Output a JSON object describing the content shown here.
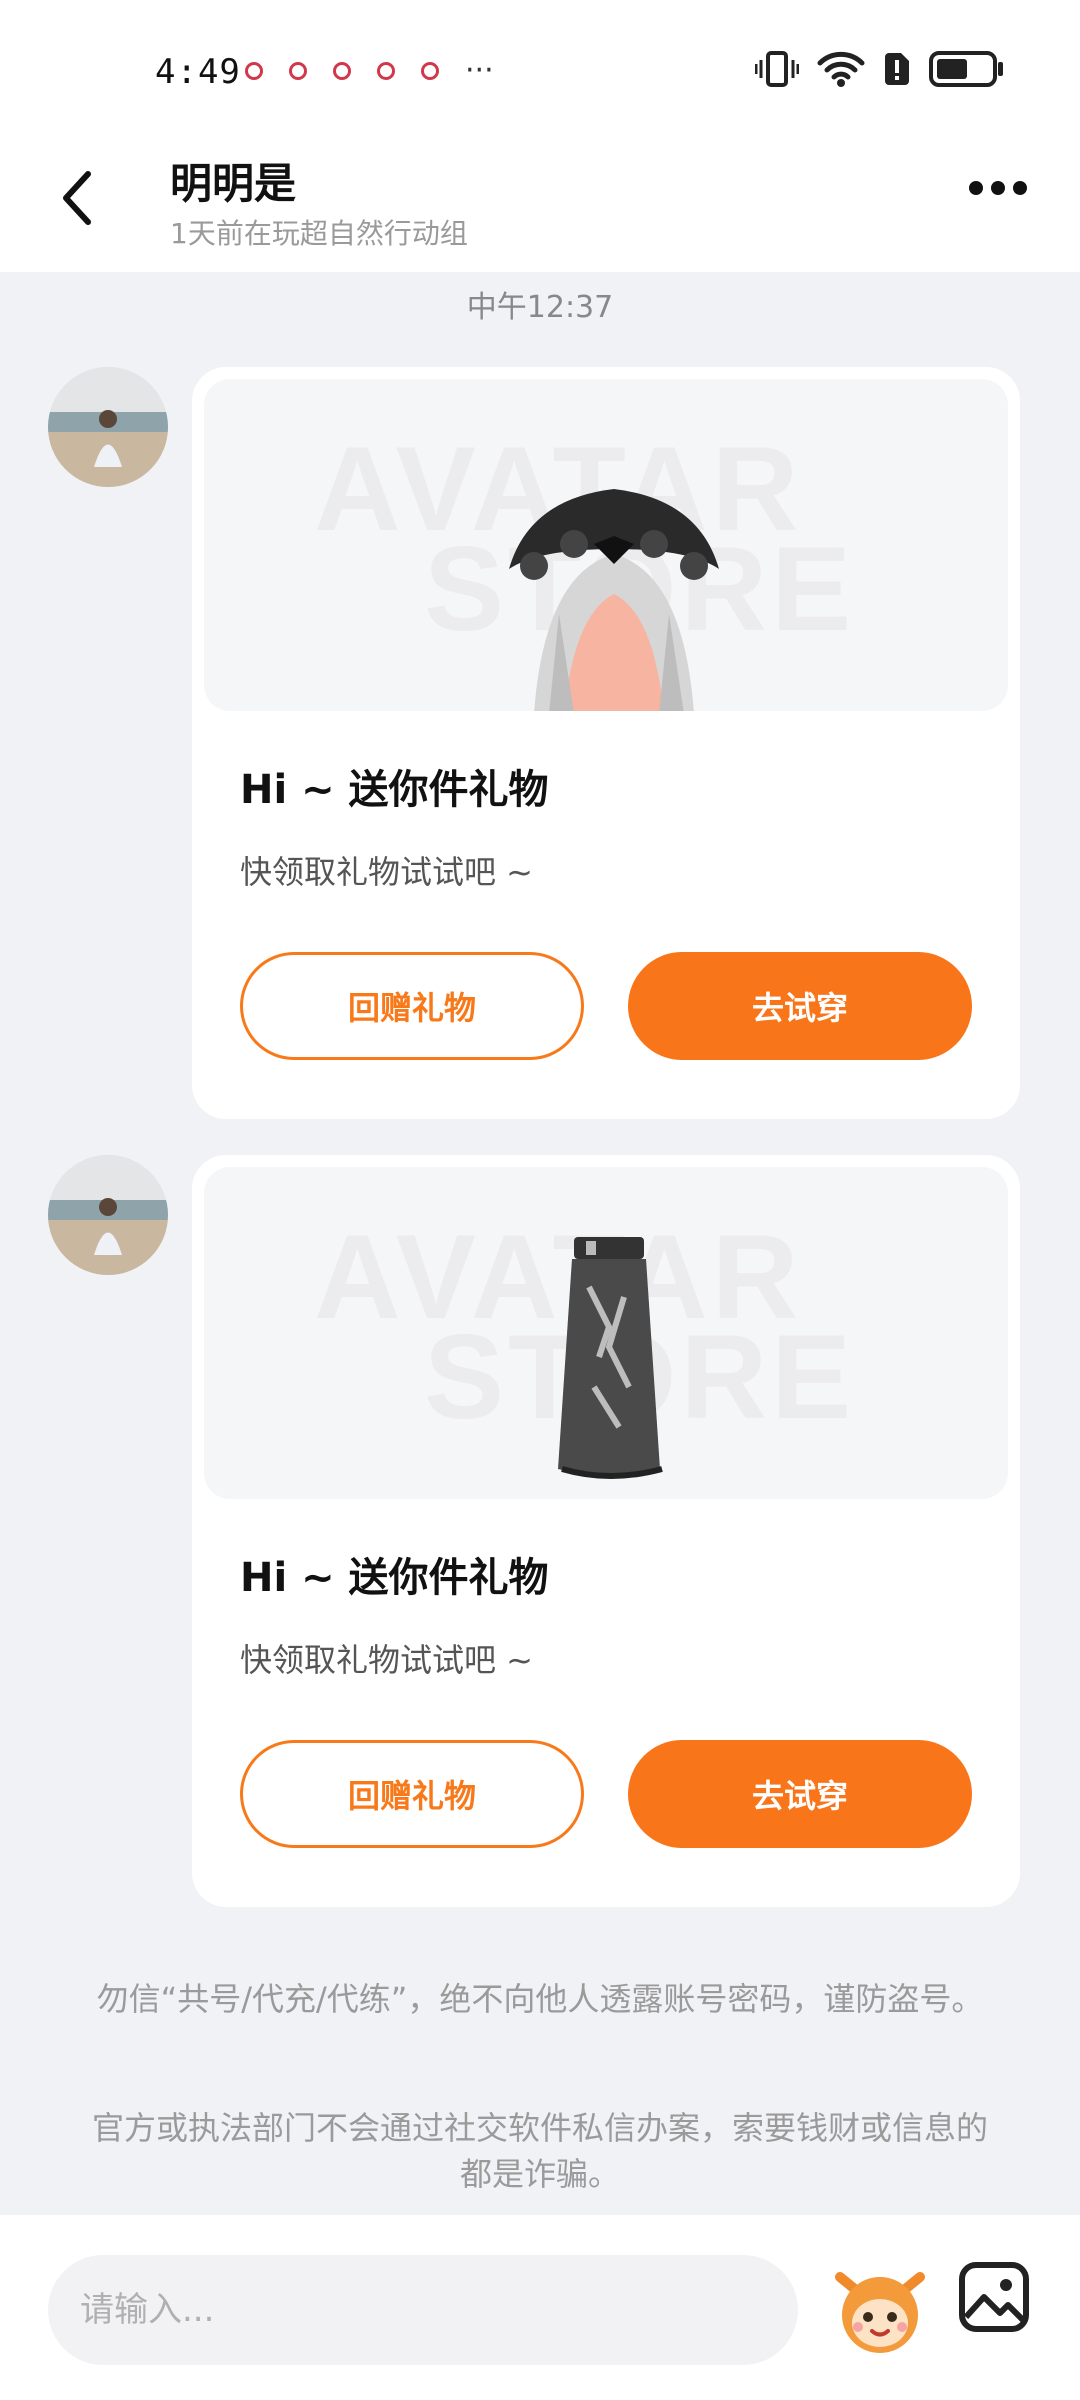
{
  "status_bar": {
    "time": "4:49",
    "more": "···"
  },
  "header": {
    "name": "明明是",
    "subtitle": "1天前在玩超自然行动组"
  },
  "chat": {
    "timestamp": "中午12:37",
    "messages": [
      {
        "watermark_line1": "AVATAR",
        "watermark_line2": "STORE",
        "title": "Hi ~ 送你件礼物",
        "desc": "快领取礼物试试吧 ~",
        "return_gift_label": "回赠礼物",
        "try_on_label": "去试穿"
      },
      {
        "watermark_line1": "AVATAR",
        "watermark_line2": "STORE",
        "title": "Hi ~ 送你件礼物",
        "desc": "快领取礼物试试吧 ~",
        "return_gift_label": "回赠礼物",
        "try_on_label": "去试穿"
      }
    ],
    "notice1": "勿信“共号/代充/代练”，绝不向他人透露账号密码，谨防盗号。",
    "notice2": "官方或执法部门不会通过社交软件私信办案，索要钱财或信息的都是诈骗。"
  },
  "input_bar": {
    "placeholder": "请输入..."
  },
  "colors": {
    "accent": "#f8751a",
    "background": "#f1f2f5"
  }
}
